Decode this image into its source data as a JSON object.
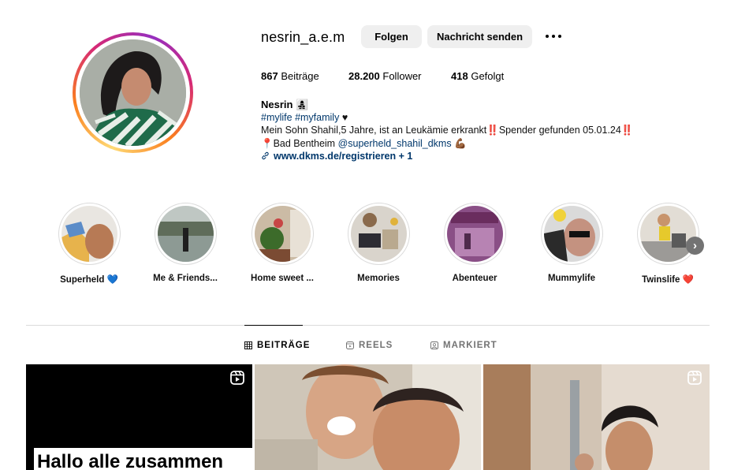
{
  "profile": {
    "username": "nesrin_a.e.m",
    "follow_label": "Folgen",
    "message_label": "Nachricht senden",
    "stats": {
      "posts": "867",
      "posts_label": "Beiträge",
      "followers": "28.200",
      "followers_label": "Follower",
      "following": "418",
      "following_label": "Gefolgt"
    },
    "bio": {
      "name": "Nesrin 👩‍👧‍👦",
      "hashtags": "#mylife #myfamily",
      "heart": "♥",
      "line1": "Mein Sohn Shahil,5 Jahre, ist an Leukämie erkrankt‼️Spender gefunden 05.01.24‼️",
      "pin": "📍",
      "location": "Bad Bentheim ",
      "mention": "@superheld_shahil_dkms",
      "muscle": "💪🏾",
      "link": "www.dkms.de/registrieren + 1"
    }
  },
  "highlights": [
    {
      "label": "Superheld 💙"
    },
    {
      "label": "Me & Friends..."
    },
    {
      "label": "Home sweet ..."
    },
    {
      "label": "Memories"
    },
    {
      "label": "Abenteuer"
    },
    {
      "label": "Mummylife"
    },
    {
      "label": "Twinslife ❤️"
    }
  ],
  "tabs": {
    "posts": "BEITRÄGE",
    "reels": "REELS",
    "tagged": "MARKIERT"
  },
  "posts": [
    {
      "caption": "Hallo alle zusammen"
    }
  ],
  "colors": {
    "link": "#00376b",
    "button_bg": "#efefef",
    "divider": "#dbdbdb"
  }
}
